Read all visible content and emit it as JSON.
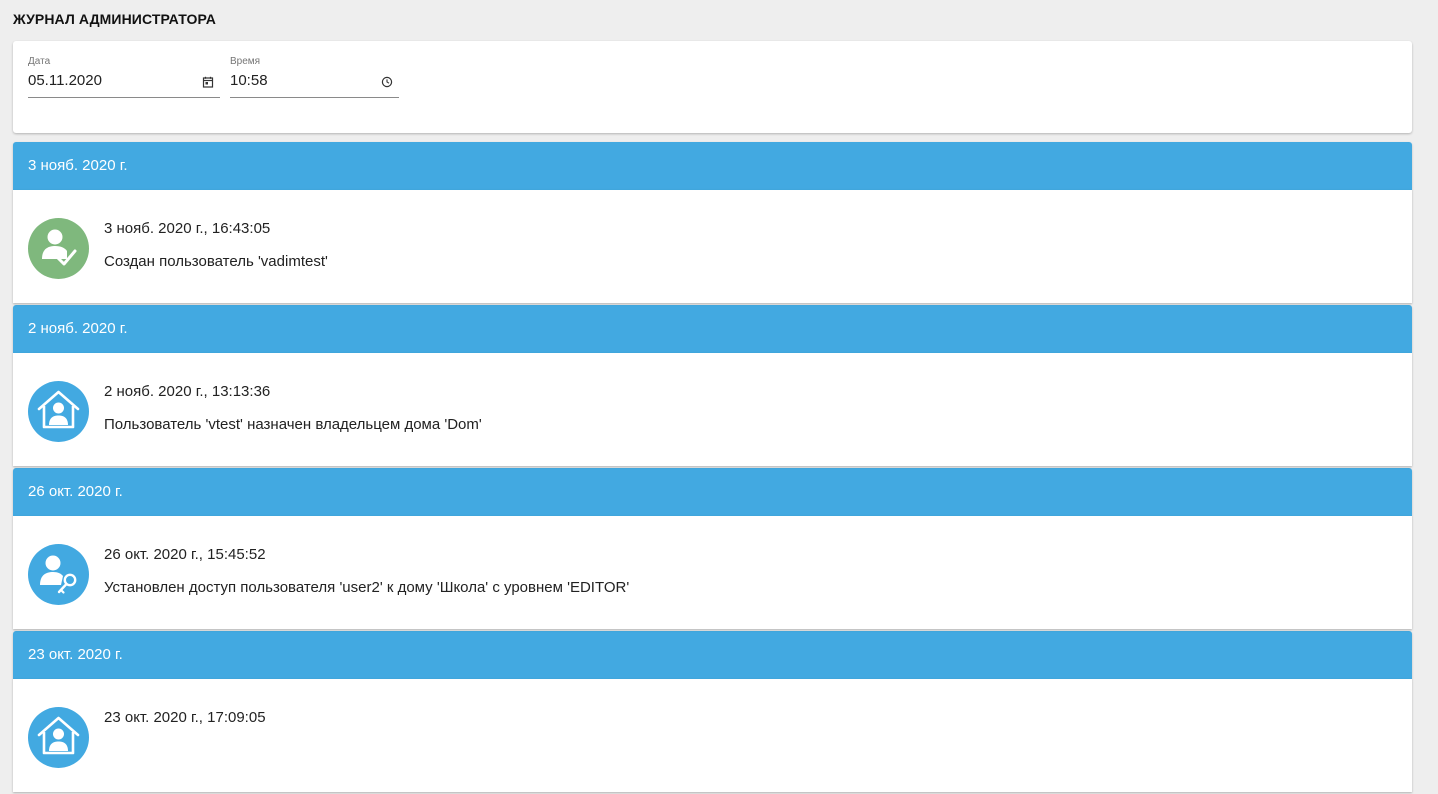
{
  "page": {
    "title": "ЖУРНАЛ АДМИНИСТРАТОРА"
  },
  "filters": {
    "date": {
      "label": "Дата",
      "value": "05.11.2020",
      "icon": "calendar-icon"
    },
    "time": {
      "label": "Время",
      "value": "10:58",
      "icon": "clock-icon"
    }
  },
  "colors": {
    "group_header": "#42a9e1",
    "avatar_green": "#7fb87d",
    "avatar_blue": "#42a9e1"
  },
  "groups": [
    {
      "date": "3 нояб. 2020 г.",
      "entries": [
        {
          "timestamp": "3 нояб. 2020 г., 16:43:05",
          "message": "Создан пользователь 'vadimtest'",
          "icon": "user-check-icon",
          "color": "#7fb87d"
        }
      ]
    },
    {
      "date": "2 нояб. 2020 г.",
      "entries": [
        {
          "timestamp": "2 нояб. 2020 г., 13:13:36",
          "message": "Пользователь 'vtest' назначен владельцем дома 'Dom'",
          "icon": "house-user-icon",
          "color": "#42a9e1"
        }
      ]
    },
    {
      "date": "26 окт. 2020 г.",
      "entries": [
        {
          "timestamp": "26 окт. 2020 г., 15:45:52",
          "message": "Установлен доступ пользователя 'user2' к дому 'Школа' с уровнем 'EDITOR'",
          "icon": "user-key-icon",
          "color": "#42a9e1"
        }
      ]
    },
    {
      "date": "23 окт. 2020 г.",
      "entries": [
        {
          "timestamp": "23 окт. 2020 г., 17:09:05",
          "message": "",
          "icon": "house-user-icon",
          "color": "#42a9e1"
        }
      ]
    }
  ]
}
